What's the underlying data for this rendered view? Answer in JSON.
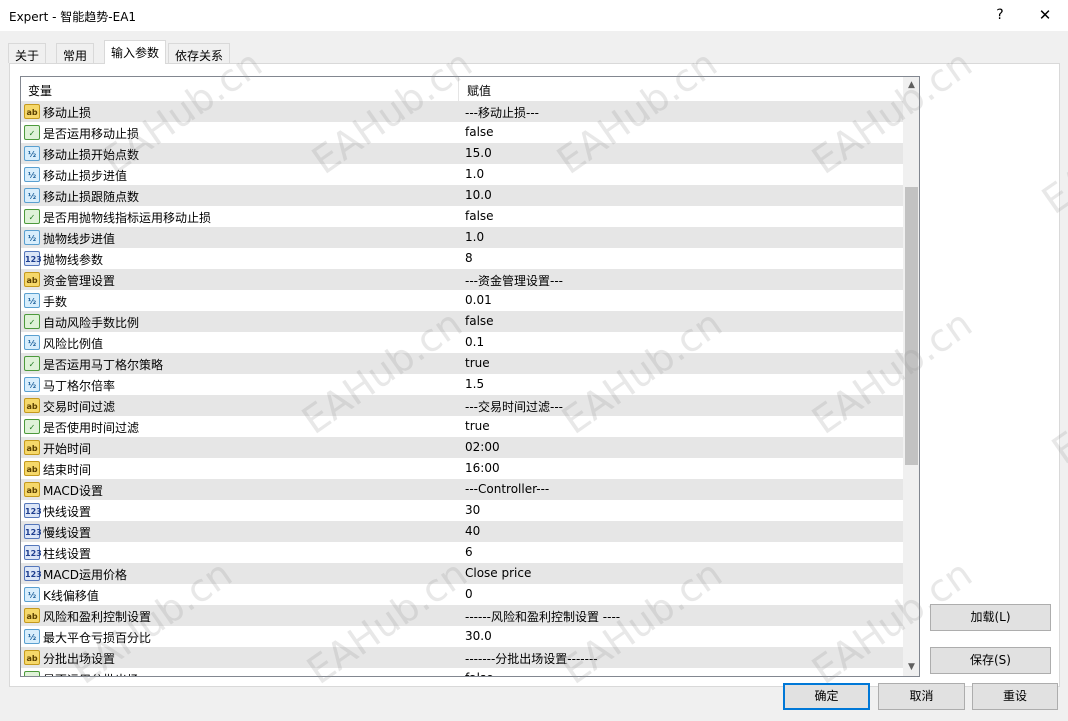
{
  "window": {
    "title": "Expert - 智能趋势-EA1",
    "help_label": "?",
    "close_label": "✕"
  },
  "tabs": [
    {
      "label": "关于",
      "active": false
    },
    {
      "label": "常用",
      "active": false
    },
    {
      "label": "输入参数",
      "active": true
    },
    {
      "label": "依存关系",
      "active": false
    }
  ],
  "grid": {
    "headers": {
      "variable": "变量",
      "value": "赋值"
    },
    "rows": [
      {
        "icon": "ab",
        "name": "移动止损",
        "value": "---移动止损---"
      },
      {
        "icon": "bool",
        "name": "是否运用移动止损",
        "value": "false"
      },
      {
        "icon": "dbl",
        "name": "移动止损开始点数",
        "value": "15.0"
      },
      {
        "icon": "dbl",
        "name": "移动止损步进值",
        "value": "1.0"
      },
      {
        "icon": "dbl",
        "name": "移动止损跟随点数",
        "value": "10.0"
      },
      {
        "icon": "bool",
        "name": "是否用抛物线指标运用移动止损",
        "value": "false"
      },
      {
        "icon": "dbl",
        "name": "抛物线步进值",
        "value": "1.0"
      },
      {
        "icon": "int",
        "name": "抛物线参数",
        "value": "8"
      },
      {
        "icon": "ab",
        "name": "资金管理设置",
        "value": "---资金管理设置---"
      },
      {
        "icon": "dbl",
        "name": "手数",
        "value": "0.01"
      },
      {
        "icon": "bool",
        "name": "自动风险手数比例",
        "value": "false"
      },
      {
        "icon": "dbl",
        "name": "风险比例值",
        "value": "0.1"
      },
      {
        "icon": "bool",
        "name": "是否运用马丁格尔策略",
        "value": "true"
      },
      {
        "icon": "dbl",
        "name": "马丁格尔倍率",
        "value": "1.5"
      },
      {
        "icon": "ab",
        "name": "交易时间过滤",
        "value": "---交易时间过滤---"
      },
      {
        "icon": "bool",
        "name": "是否使用时间过滤",
        "value": "true"
      },
      {
        "icon": "ab",
        "name": "开始时间",
        "value": "02:00"
      },
      {
        "icon": "ab",
        "name": "结束时间",
        "value": "16:00"
      },
      {
        "icon": "ab",
        "name": "MACD设置",
        "value": "---Controller---"
      },
      {
        "icon": "int",
        "name": "快线设置",
        "value": "30"
      },
      {
        "icon": "int",
        "name": "慢线设置",
        "value": "40"
      },
      {
        "icon": "int",
        "name": "柱线设置",
        "value": "6"
      },
      {
        "icon": "int",
        "name": "MACD运用价格",
        "value": "Close price"
      },
      {
        "icon": "dbl",
        "name": "K线偏移值",
        "value": "0"
      },
      {
        "icon": "ab",
        "name": "风险和盈利控制设置",
        "value": "------风险和盈利控制设置 ----"
      },
      {
        "icon": "dbl",
        "name": "最大平仓亏损百分比",
        "value": "30.0"
      },
      {
        "icon": "ab",
        "name": "分批出场设置",
        "value": "-------分批出场设置-------"
      },
      {
        "icon": "bool",
        "name": "是否运用分批出场",
        "value": "false"
      }
    ]
  },
  "icons": {
    "ab": {
      "name": "string-param-icon",
      "glyph": "ab"
    },
    "bool": {
      "name": "bool-param-icon",
      "glyph": "✓"
    },
    "dbl": {
      "name": "double-param-icon",
      "glyph": "½"
    },
    "int": {
      "name": "int-param-icon",
      "glyph": "123"
    }
  },
  "buttons": {
    "load": "加载(L)",
    "save": "保存(S)",
    "ok": "确定",
    "cancel": "取消",
    "reset": "重设"
  },
  "watermark": "EAHub.cn"
}
